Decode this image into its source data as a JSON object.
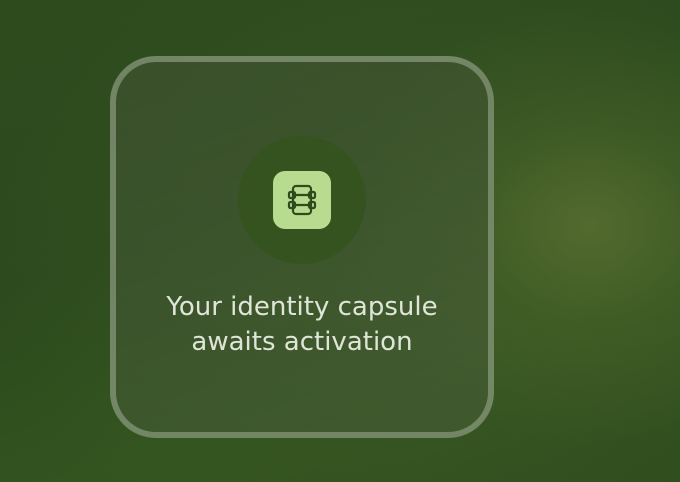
{
  "empty_state": {
    "icon": "capsule-icon",
    "message_line_1": "Your identity capsule",
    "message_line_2": "awaits activation"
  },
  "colors": {
    "background": "#2e4b1e",
    "card_border": "#a0af96",
    "icon_halo": "#35531f",
    "icon_tile": "#b8dc8f",
    "icon_stroke": "#2f4a1c",
    "text": "#dfe6d8"
  }
}
